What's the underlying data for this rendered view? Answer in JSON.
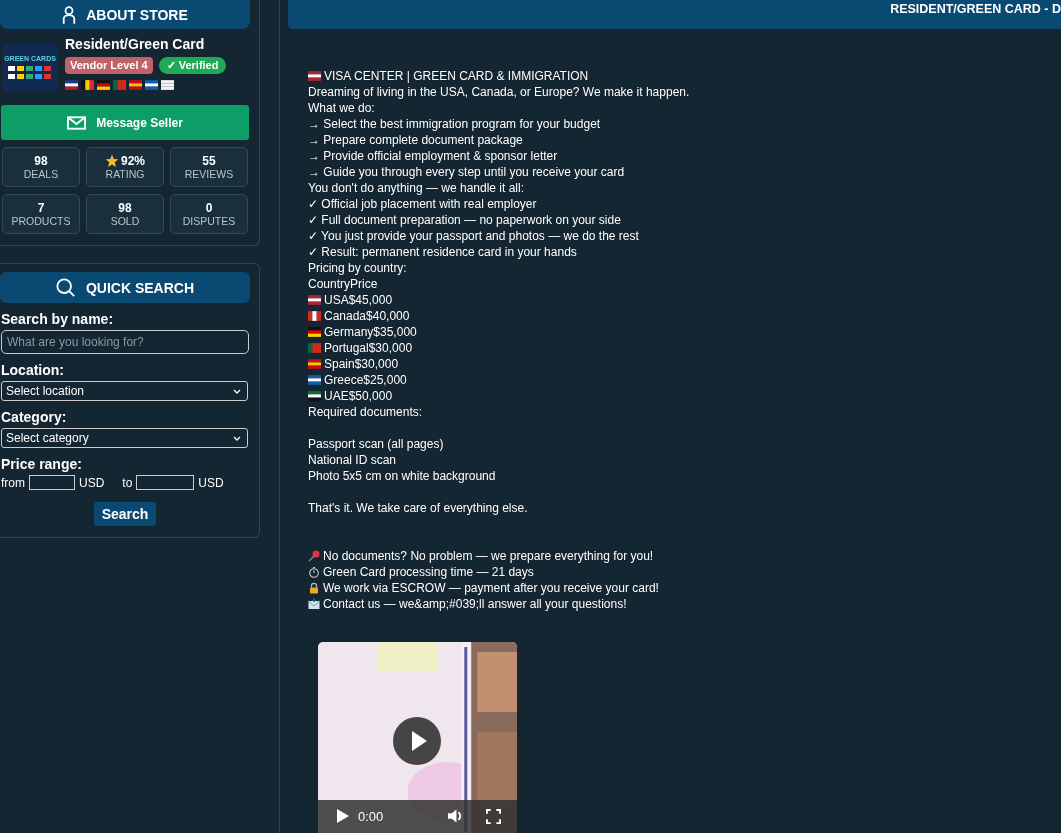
{
  "store": {
    "header": "ABOUT STORE",
    "name": "Resident/Green Card",
    "logo_text": "GREEN CARDS",
    "level_badge": "Vendor Level 4",
    "verified_badge": "✓ Verified",
    "flags": [
      {
        "kind": "flag-gb"
      },
      {
        "kind": "flag-be"
      },
      {
        "kind": "flag-de"
      },
      {
        "kind": "flag-pt"
      },
      {
        "kind": "flag-es"
      },
      {
        "kind": "flag-gr"
      },
      {
        "kind": "flag-cy"
      }
    ],
    "message_button": "Message Seller",
    "stats": [
      {
        "value": "98",
        "label": "DEALS",
        "kind": "plain"
      },
      {
        "value": "92%",
        "label": "RATING",
        "kind": "star"
      },
      {
        "value": "55",
        "label": "REVIEWS",
        "kind": "plain"
      },
      {
        "value": "7",
        "label": "PRODUCTS",
        "kind": "plain"
      },
      {
        "value": "98",
        "label": "SOLD",
        "kind": "plain"
      },
      {
        "value": "0",
        "label": "DISPUTES",
        "kind": "plain"
      }
    ]
  },
  "search": {
    "header": "QUICK SEARCH",
    "name_label": "Search by name:",
    "placeholder": "What are you looking for?",
    "location_label": "Location:",
    "location_value": "Select location",
    "category_label": "Category:",
    "category_value": "Select category",
    "price_label": "Price range:",
    "from": "from",
    "to": "to",
    "currency_from": "USD",
    "currency_to": "USD",
    "button": "Search"
  },
  "listing": {
    "title": "RESIDENT/GREEN CARD - D",
    "lines": [
      {
        "kind": "flag-us",
        "text": "VISA CENTER | GREEN CARD & IMMIGRATION"
      },
      {
        "kind": "text",
        "text": "Dreaming of living in the USA, Canada, or Europe? We make it happen."
      },
      {
        "kind": "text",
        "text": "What we do:"
      },
      {
        "kind": "text",
        "text": "→ Select the best immigration program for your budget"
      },
      {
        "kind": "text",
        "text": "→ Prepare complete document package"
      },
      {
        "kind": "text",
        "text": "→ Provide official employment & sponsor letter"
      },
      {
        "kind": "text",
        "text": "→ Guide you through every step until you receive your card"
      },
      {
        "kind": "text",
        "text": "You don't do anything — we handle it all:"
      },
      {
        "kind": "text",
        "text": "✓ Official job placement with real employer"
      },
      {
        "kind": "text",
        "text": "✓ Full document preparation — no paperwork on your side"
      },
      {
        "kind": "text",
        "text": "✓ You just provide your passport and photos — we do the rest"
      },
      {
        "kind": "text",
        "text": "✓ Result: permanent residence card in your hands"
      },
      {
        "kind": "text",
        "text": "Pricing by country:"
      },
      {
        "kind": "text",
        "text": "CountryPrice"
      },
      {
        "kind": "flag-us",
        "text": "USA$45,000"
      },
      {
        "kind": "flag-ca",
        "text": "Canada$40,000"
      },
      {
        "kind": "flag-de",
        "text": "Germany$35,000"
      },
      {
        "kind": "flag-pt",
        "text": "Portugal$30,000"
      },
      {
        "kind": "flag-es",
        "text": "Spain$30,000"
      },
      {
        "kind": "flag-gr",
        "text": "Greece$25,000"
      },
      {
        "kind": "flag-ae",
        "text": "UAE$50,000"
      },
      {
        "kind": "text",
        "text": "Required documents:"
      },
      {
        "kind": "gap"
      },
      {
        "kind": "text",
        "text": "Passport scan (all pages)"
      },
      {
        "kind": "text",
        "text": "National ID scan"
      },
      {
        "kind": "text",
        "text": "Photo 5x5 cm on white background"
      },
      {
        "kind": "gap"
      },
      {
        "kind": "text",
        "text": "That's it. We take care of everything else."
      },
      {
        "kind": "gap"
      },
      {
        "kind": "gap"
      },
      {
        "kind": "pin",
        "text": "No documents? No problem — we prepare everything for you!"
      },
      {
        "kind": "timer",
        "text": "Green Card processing time — 21 days"
      },
      {
        "kind": "lock",
        "text": "We work via ESCROW — payment after you receive your card!"
      },
      {
        "kind": "mail",
        "text": "Contact us — we&amp;#039;ll answer all your questions!"
      }
    ],
    "video": {
      "kind": "picture",
      "time": "0:00"
    }
  }
}
